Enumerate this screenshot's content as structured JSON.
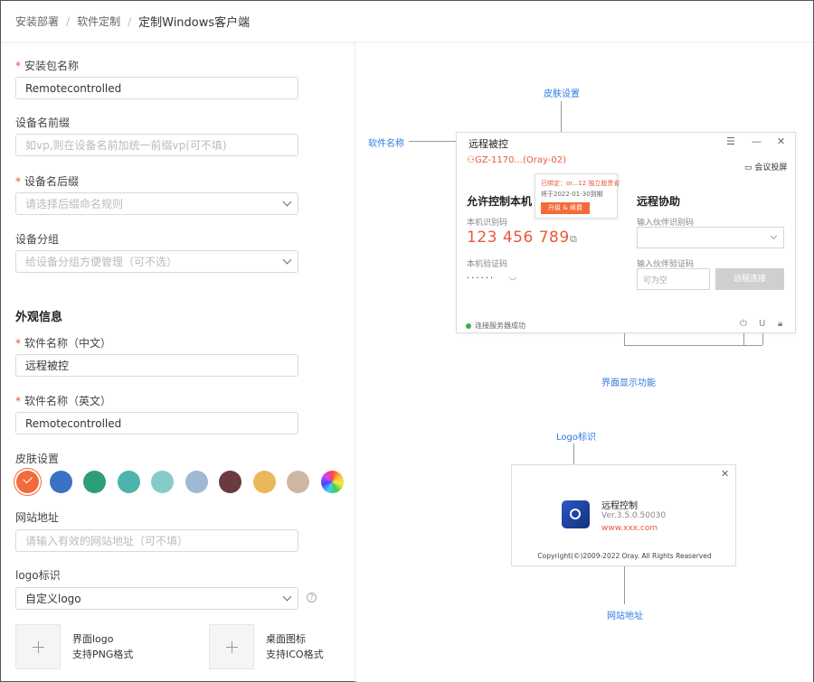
{
  "breadcrumb": {
    "items": [
      "安装部署",
      "软件定制"
    ],
    "current": "定制Windows客户端"
  },
  "form": {
    "package_name": {
      "label": "安装包名称",
      "value": "Remotecontrolled"
    },
    "device_prefix": {
      "label": "设备名前缀",
      "placeholder": "如vp,则在设备名前加统一前缀vp(可不填)"
    },
    "device_suffix": {
      "label": "设备名后缀",
      "placeholder": "请选择后缀命名规则"
    },
    "device_group": {
      "label": "设备分组",
      "placeholder": "给设备分组方便管理（可不选）"
    },
    "appearance_title": "外观信息",
    "soft_name_cn": {
      "label": "软件名称（中文）",
      "value": "远程被控"
    },
    "soft_name_en": {
      "label": "软件名称（英文）",
      "value": "Remotecontrolled"
    },
    "skin": {
      "label": "皮肤设置",
      "colors": [
        "#f26b3a",
        "#3a72c4",
        "#2e9e76",
        "#4db3ad",
        "#86cbc8",
        "#9fb8d6",
        "#6b3a3e",
        "#eab85a",
        "#cdb7a3"
      ]
    },
    "website": {
      "label": "网站地址",
      "placeholder": "请输入有效的网站地址（可不填）"
    },
    "logo": {
      "label": "logo标识",
      "value": "自定义logo"
    },
    "upload_ui": {
      "line1": "界面logo",
      "line2": "支持PNG格式"
    },
    "upload_desk": {
      "line1": "桌面图标",
      "line2": "支持ICO格式"
    }
  },
  "preview": {
    "callouts": {
      "skin": "皮肤设置",
      "soft_name": "软件名称",
      "ui_features": "界面显示功能",
      "logo": "Logo标识",
      "website": "网站地址"
    },
    "window": {
      "title": "远程被控",
      "device_id": "GZ-1170...(Oray-02)",
      "meeting": "会议投屏",
      "popup_a": "已绑定：or...12 独立版贵省",
      "popup_b": "将于2022-01-30到期",
      "popup_btn": "升级 & 续费",
      "allow_title": "允许控制本机",
      "local_id_label": "本机识别码",
      "local_id": "123 456 789",
      "local_code_label": "本机验证码",
      "local_code": "······",
      "assist_title": "远程协助",
      "partner_id_label": "输入伙伴识别码",
      "partner_code_label": "输入伙伴验证码",
      "partner_code_ph": "可为空",
      "connect_btn": "远程连接",
      "status": "连接服务器成功"
    },
    "about": {
      "app_name": "远程控制",
      "version": "Ver.3.5.0.50030",
      "url": "www.xxx.com",
      "copyright": "Copyright(©)2009-2022 Oray. All Rights Reaserved"
    }
  }
}
